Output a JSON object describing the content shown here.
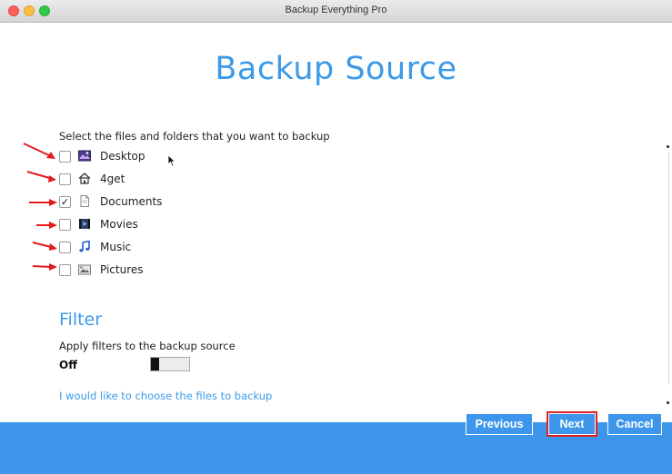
{
  "window": {
    "title": "Backup Everything Pro"
  },
  "page": {
    "title": "Backup Source",
    "instruction": "Select the files and folders that you want to backup"
  },
  "sources": [
    {
      "label": "Desktop",
      "checked": false,
      "icon": "desktop-folder-icon"
    },
    {
      "label": "4get",
      "checked": false,
      "icon": "home-icon"
    },
    {
      "label": "Documents",
      "checked": true,
      "icon": "documents-folder-icon"
    },
    {
      "label": "Movies",
      "checked": false,
      "icon": "movies-folder-icon"
    },
    {
      "label": "Music",
      "checked": false,
      "icon": "music-folder-icon"
    },
    {
      "label": "Pictures",
      "checked": false,
      "icon": "pictures-folder-icon"
    }
  ],
  "filter": {
    "title": "Filter",
    "description": "Apply filters to the backup source",
    "state": "Off",
    "choose_link": "I would like to choose the files to backup"
  },
  "footer": {
    "previous_label": "Previous",
    "next_label": "Next",
    "cancel_label": "Cancel"
  },
  "colors": {
    "accent": "#3d9ae8",
    "footer": "#3d96ea",
    "highlight": "#e02020",
    "annotation_arrow": "#e31b1b"
  }
}
